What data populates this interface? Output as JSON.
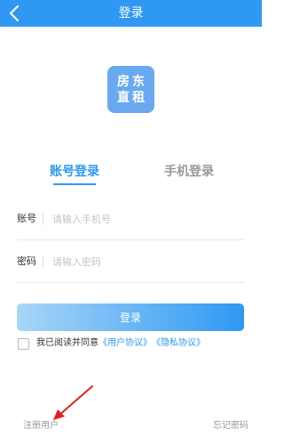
{
  "header": {
    "title": "登录",
    "back_icon": "chevron-left-icon",
    "background": "#2f98f3"
  },
  "logo": {
    "line1": "房东",
    "line2": "直租",
    "background": "#6aa9f0"
  },
  "tabs": [
    {
      "label": "账号登录",
      "active": true
    },
    {
      "label": "手机登录",
      "active": false
    }
  ],
  "form": {
    "account": {
      "label": "账号",
      "placeholder": "请输入手机号",
      "value": ""
    },
    "password": {
      "label": "密码",
      "placeholder": "请输入密码",
      "value": ""
    }
  },
  "login_button": "登录",
  "agreement": {
    "checked": false,
    "text": "我已阅读并同意",
    "user_agreement": "《用户协议》",
    "privacy_policy": "《隐私协议》"
  },
  "footer": {
    "register": "注册用户",
    "forgot_password": "忘记密码"
  },
  "colors": {
    "accent": "#2f98f3",
    "annotation_arrow": "#e02020"
  }
}
